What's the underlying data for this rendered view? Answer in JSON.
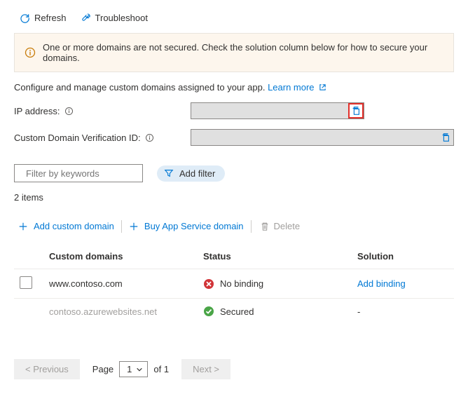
{
  "toolbar": {
    "refresh": "Refresh",
    "troubleshoot": "Troubleshoot"
  },
  "banner": {
    "message": "One or more domains are not secured. Check the solution column below for how to secure your domains."
  },
  "description": {
    "text": "Configure and manage custom domains assigned to your app. ",
    "link": "Learn more"
  },
  "fields": {
    "ip_label": "IP address:",
    "ip_value": "",
    "cdv_label": "Custom Domain Verification ID:",
    "cdv_value": ""
  },
  "filter": {
    "search_placeholder": "Filter by keywords",
    "add_filter": "Add filter"
  },
  "count_text": "2 items",
  "actions": {
    "add_custom_domain": "Add custom domain",
    "buy_app_service_domain": "Buy App Service domain",
    "delete": "Delete"
  },
  "table": {
    "headers": {
      "domain": "Custom domains",
      "status": "Status",
      "solution": "Solution"
    },
    "rows": [
      {
        "domain": "www.contoso.com",
        "status": "No binding",
        "status_kind": "error",
        "solution": "Add binding",
        "solution_is_link": true,
        "selectable": true
      },
      {
        "domain": "contoso.azurewebsites.net",
        "status": "Secured",
        "status_kind": "success",
        "solution": "-",
        "solution_is_link": false,
        "selectable": false
      }
    ]
  },
  "pager": {
    "previous": "< Previous",
    "next": "Next >",
    "page_label": "Page",
    "page_current": "1",
    "page_of": "of 1"
  }
}
